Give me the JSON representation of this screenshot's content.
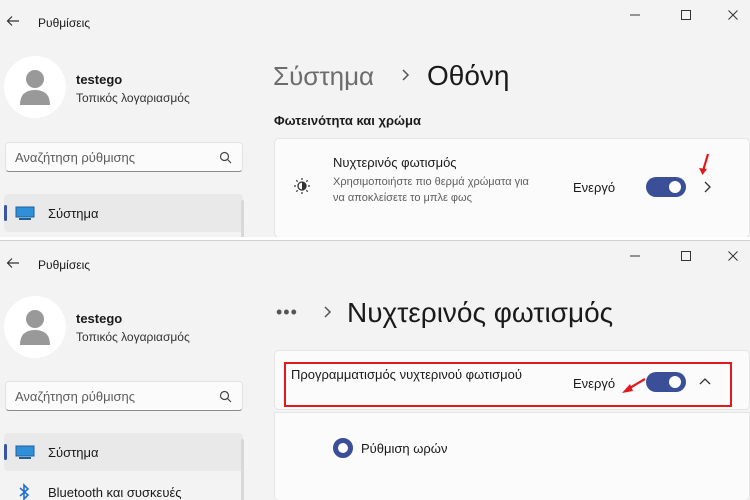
{
  "top_window": {
    "app_title": "Ρυθμίσεις",
    "user": {
      "name": "testego",
      "account_type": "Τοπικός λογαριασμός"
    },
    "search": {
      "placeholder": "Αναζήτηση ρύθμισης"
    },
    "nav": [
      {
        "label": "Σύστημα",
        "icon": "display-icon",
        "active": true
      }
    ],
    "breadcrumb": {
      "parent": "Σύστημα",
      "current": "Οθόνη"
    },
    "section_title": "Φωτεινότητα και χρώμα",
    "night_light": {
      "title": "Νυχτερινός φωτισμός",
      "description": "Χρησιμοποιήστε πιο θερμά χρώματα για να αποκλείσετε το μπλε φως",
      "status": "Ενεργό",
      "toggle_on": true
    }
  },
  "bottom_window": {
    "app_title": "Ρυθμίσεις",
    "user": {
      "name": "testego",
      "account_type": "Τοπικός λογαριασμός"
    },
    "search": {
      "placeholder": "Αναζήτηση ρύθμισης"
    },
    "nav": [
      {
        "label": "Σύστημα",
        "icon": "display-icon",
        "active": true
      },
      {
        "label": "Bluetooth και συσκευές",
        "icon": "bluetooth-icon",
        "active": false
      }
    ],
    "breadcrumb": {
      "ellipsis": "•••",
      "current": "Νυχτερινός φωτισμός"
    },
    "schedule": {
      "title": "Προγραμματισμός νυχτερινού φωτισμού",
      "status": "Ενεργό",
      "toggle_on": true
    },
    "option": {
      "label": "Ρύθμιση ωρών",
      "selected": true
    }
  },
  "colors": {
    "accent": "#3b4f98",
    "highlight": "#e0191f",
    "background": "#f3f3f3"
  }
}
